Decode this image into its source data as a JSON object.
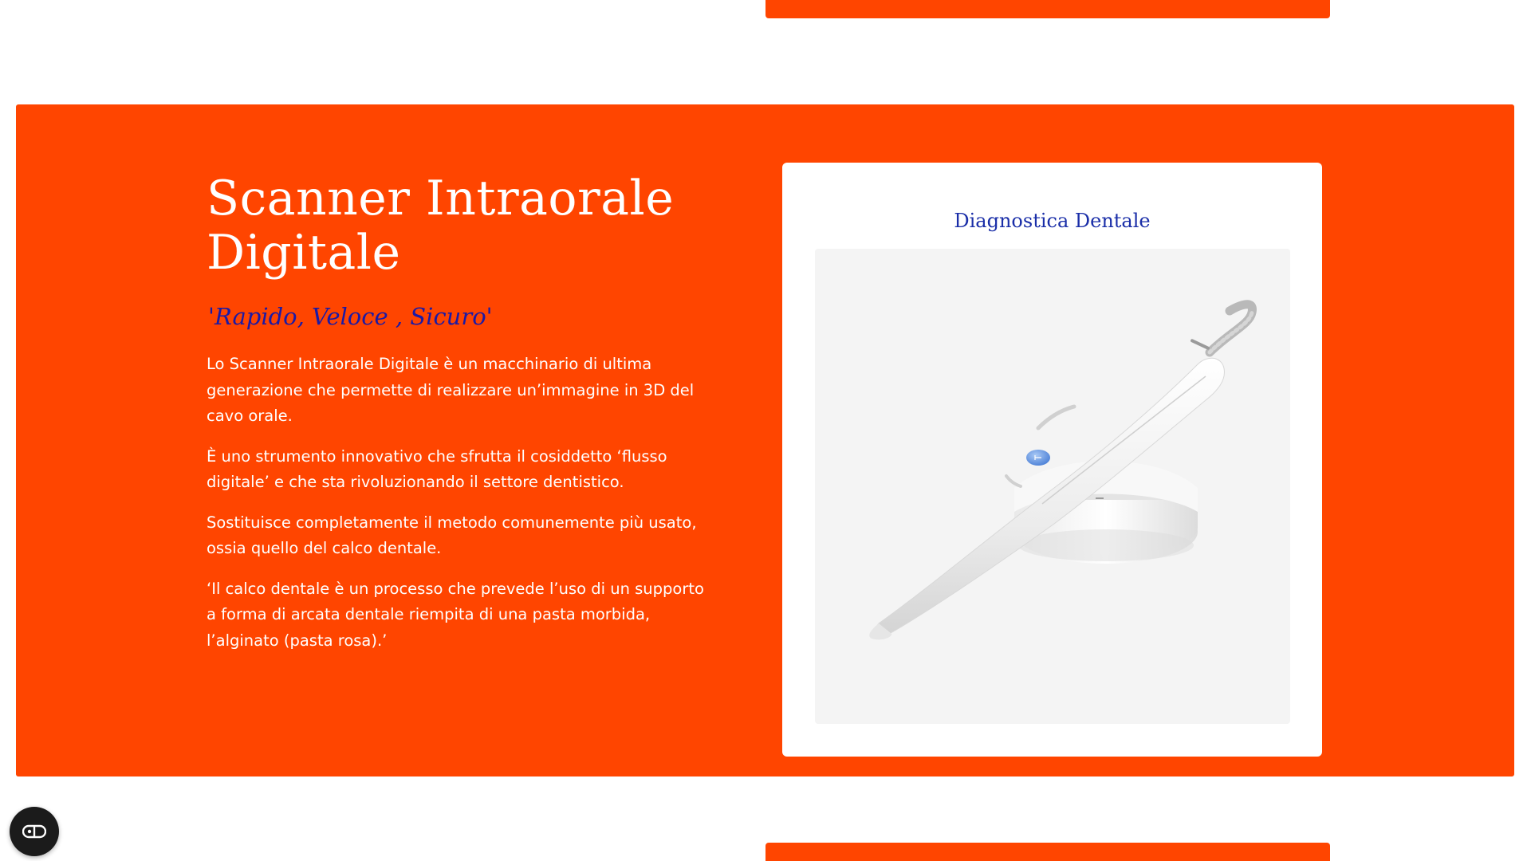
{
  "hero": {
    "title": "Scanner Intraorale Digitale",
    "tagline": "'Rapido, Veloce , Sicuro'",
    "paragraphs": [
      "Lo Scanner Intraorale Digitale è un macchinario di ultima generazione che permette di realizzare un’immagine in 3D del cavo orale.",
      "È uno strumento innovativo che sfrutta il cosiddetto ‘flusso digitale’ e che sta rivoluzionando il settore dentistico.",
      "Sostituisce completamente il metodo comunemente più usato, ossia quello del calco dentale.",
      "‘Il calco dentale è un processo che prevede l’uso di un supporto a forma di arcata dentale riempita di una pasta morbida, l’alginato (pasta rosa).’"
    ]
  },
  "card": {
    "title": "Diagnostica Dentale",
    "image": "intraoral-scanner-device"
  },
  "accessibility": {
    "icon": "accessibility-toggle-icon"
  },
  "colors": {
    "accent": "#ff4500",
    "tagline": "#1a1aa6",
    "card_title": "#1a2ea8",
    "text": "#ffffff"
  }
}
